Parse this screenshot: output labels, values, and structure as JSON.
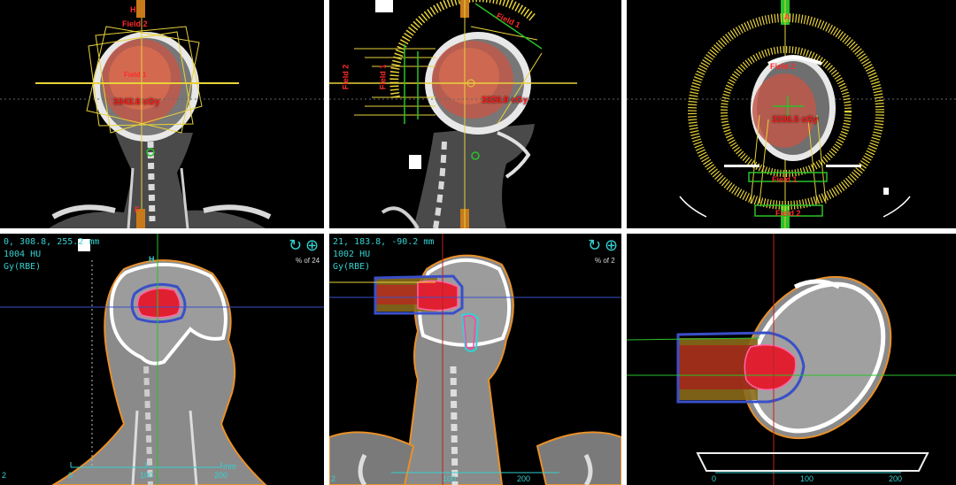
{
  "panels": {
    "coronal_beam": {
      "field_label_top": "Field 2",
      "field_label_mid": "Field 1",
      "dose": "3343.6 cGy",
      "orient_top": "H",
      "orient_bottom": "F"
    },
    "sagittal_beam": {
      "field_label_top": "Field 1",
      "field_label_left": "Field 2",
      "field_label_left2": "Field 1",
      "dose": "3326.9 cGy"
    },
    "axial_beam": {
      "orient_top": "A",
      "field_label": "Field 2",
      "dose": "3336.5 cGy",
      "field_label_low": "Field 1",
      "field_label_bottom": "Field 2"
    },
    "sagittal_dose": {
      "coords": "0,   308.8,   255.2   mm",
      "hu": "1004  HU",
      "unit": "Gy(RBE)",
      "pct": "% of 24",
      "orient_top": "H",
      "scale_unit": "mm",
      "scale_0": "0",
      "scale_100": "100",
      "scale_200": "200",
      "corner": "2"
    },
    "coronal_dose": {
      "coords": "21,   183.8,   -90.2   mm",
      "hu": "1002  HU",
      "unit": "Gy(RBE)",
      "pct": "% of 2",
      "scale_100": "100",
      "scale_200": "200",
      "corner": "2"
    },
    "axial_dose": {
      "scale_0": "0",
      "scale_100": "100",
      "scale_200": "200"
    }
  },
  "controls": {
    "rotate_icon": "rotate-icon",
    "crosshair_icon": "crosshair-icon"
  },
  "colors": {
    "yellow": "#e8d23a",
    "cyan": "#35d0d0",
    "red": "#ff2020",
    "dose_red": "#d4202a",
    "dose_blue": "#3a4fc8",
    "body_orange": "#e8902a",
    "green": "#29c229"
  }
}
